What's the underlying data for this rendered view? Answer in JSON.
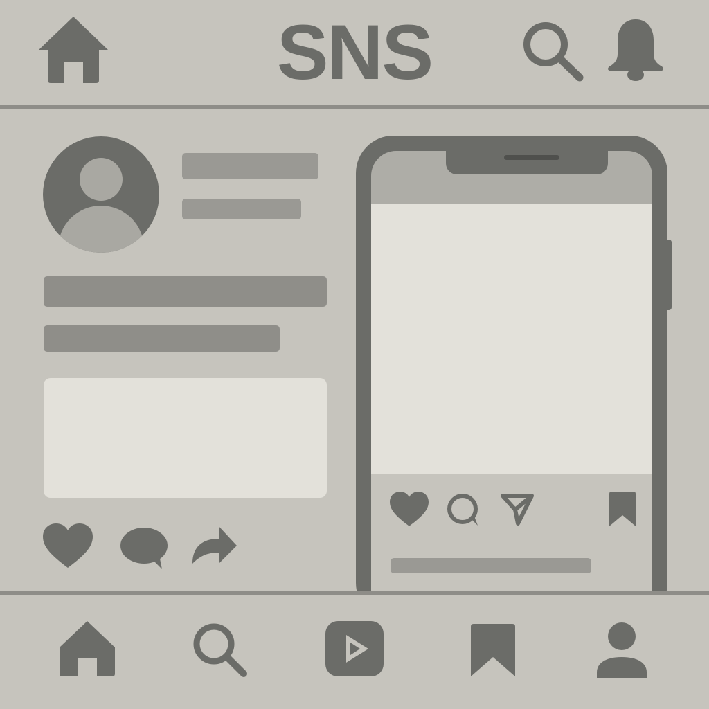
{
  "header": {
    "title": "SNS",
    "icons": {
      "left": "home-icon",
      "search": "search-icon",
      "notifications": "bell-icon"
    }
  },
  "post": {
    "actions": [
      "heart-icon",
      "comment-icon",
      "share-icon"
    ]
  },
  "phone": {
    "actions": [
      "heart-icon",
      "comment-icon",
      "send-icon",
      "bookmark-icon"
    ]
  },
  "bottom_nav": {
    "items": [
      "home-icon",
      "search-icon",
      "play-icon",
      "bookmark-icon",
      "profile-icon"
    ]
  },
  "colors": {
    "background": "#c6c4bd",
    "icon": "#6b6c68",
    "placeholder": "#9a9994",
    "media": "#e3e1da"
  }
}
